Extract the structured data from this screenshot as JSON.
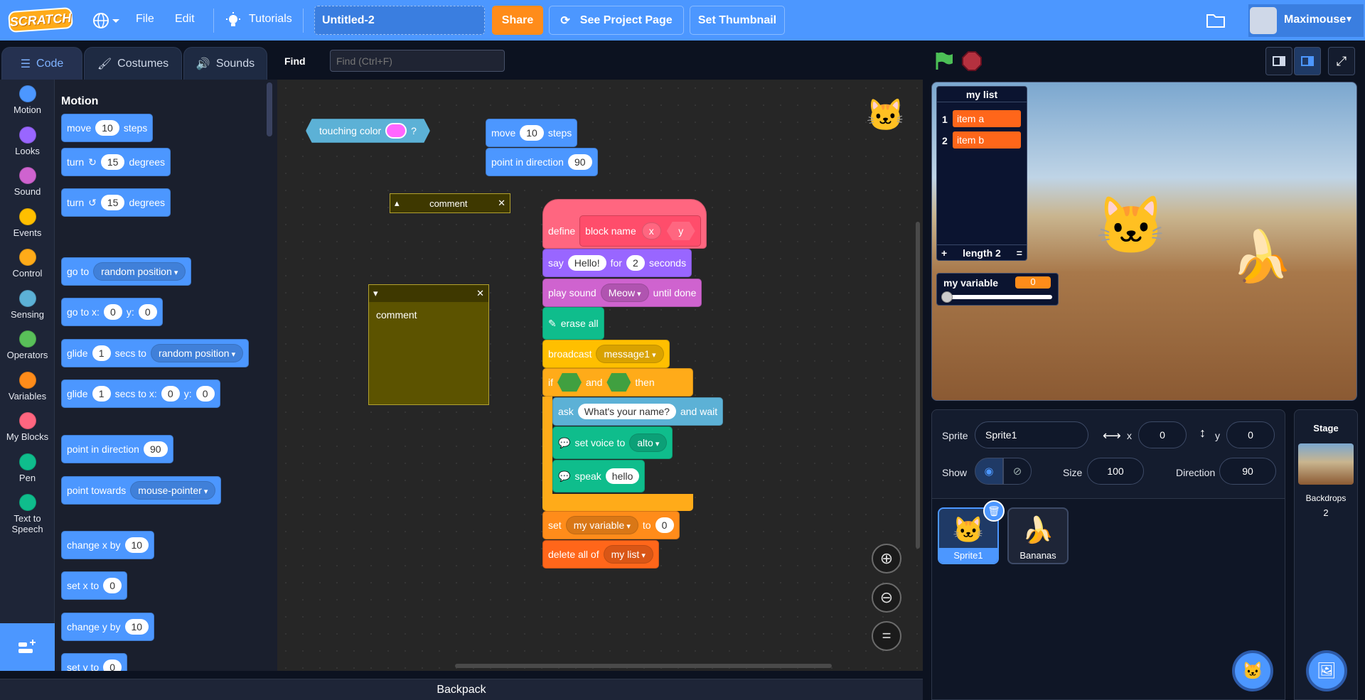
{
  "menubar": {
    "logo": "SCRATCH",
    "file": "File",
    "edit": "Edit",
    "tutorials": "Tutorials",
    "project_title": "Untitled-2",
    "share": "Share",
    "see_project_page": "See Project Page",
    "set_thumbnail": "Set Thumbnail",
    "username": "Maximouse"
  },
  "tabs": {
    "code": "Code",
    "costumes": "Costumes",
    "sounds": "Sounds"
  },
  "find": {
    "label": "Find",
    "placeholder": "Find (Ctrl+F)"
  },
  "categories": [
    {
      "label": "Motion",
      "color": "#4c97ff"
    },
    {
      "label": "Looks",
      "color": "#9966ff"
    },
    {
      "label": "Sound",
      "color": "#cf63cf"
    },
    {
      "label": "Events",
      "color": "#ffbf00"
    },
    {
      "label": "Control",
      "color": "#ffab19"
    },
    {
      "label": "Sensing",
      "color": "#5cb1d6"
    },
    {
      "label": "Operators",
      "color": "#59c059"
    },
    {
      "label": "Variables",
      "color": "#ff8c1a"
    },
    {
      "label": "My Blocks",
      "color": "#ff6680"
    },
    {
      "label": "Pen",
      "color": "#0fbd8c"
    },
    {
      "label": "Text to Speech",
      "color": "#0fbd8c"
    }
  ],
  "palette": {
    "heading": "Motion",
    "move": {
      "a": "move",
      "n": "10",
      "b": "steps"
    },
    "turn_cw": {
      "a": "turn",
      "n": "15",
      "b": "degrees"
    },
    "turn_ccw": {
      "a": "turn",
      "n": "15",
      "b": "degrees"
    },
    "goto": {
      "a": "go to",
      "dd": "random position"
    },
    "gotoxy": {
      "a": "go to x:",
      "x": "0",
      "yl": "y:",
      "y": "0"
    },
    "glide": {
      "a": "glide",
      "n": "1",
      "b": "secs to",
      "dd": "random position"
    },
    "glidexy": {
      "a": "glide",
      "n": "1",
      "b": "secs to x:",
      "x": "0",
      "yl": "y:",
      "y": "0"
    },
    "pointdir": {
      "a": "point in direction",
      "n": "90"
    },
    "pointtowards": {
      "a": "point towards",
      "dd": "mouse-pointer"
    },
    "changex": {
      "a": "change x by",
      "n": "10"
    },
    "setx": {
      "a": "set x to",
      "n": "0"
    },
    "changey": {
      "a": "change y by",
      "n": "10"
    },
    "sety": {
      "a": "set y to",
      "n": "0"
    }
  },
  "script": {
    "touching": {
      "a": "touching color",
      "b": "?"
    },
    "move": {
      "a": "move",
      "n": "10",
      "b": "steps"
    },
    "pointdir": {
      "a": "point in direction",
      "n": "90"
    },
    "comment_small": "comment",
    "comment_big": "comment",
    "define": {
      "a": "define",
      "name": "block name",
      "x": "x",
      "y": "y"
    },
    "say": {
      "a": "say",
      "msg": "Hello!",
      "b": "for",
      "n": "2",
      "c": "seconds"
    },
    "playsound": {
      "a": "play sound",
      "dd": "Meow",
      "b": "until done"
    },
    "erase": "erase all",
    "broadcast": {
      "a": "broadcast",
      "dd": "message1"
    },
    "if": {
      "a": "if",
      "and": "and",
      "then": "then"
    },
    "ask": {
      "a": "ask",
      "q": "What's your name?",
      "b": "and wait"
    },
    "setvoice": {
      "a": "set voice to",
      "dd": "alto"
    },
    "speak": {
      "a": "speak",
      "msg": "hello"
    },
    "setvar": {
      "a": "set",
      "dd": "my variable",
      "b": "to",
      "n": "0"
    },
    "deleteall": {
      "a": "delete all of",
      "dd": "my list"
    }
  },
  "backpack": "Backpack",
  "stage": {
    "list_title": "my list",
    "list_items": [
      {
        "i": "1",
        "v": "item a"
      },
      {
        "i": "2",
        "v": "item b"
      }
    ],
    "list_add": "+",
    "list_length": "length 2",
    "list_eq": "=",
    "var_name": "my variable",
    "var_value": "0"
  },
  "sprite_info": {
    "sprite_label": "Sprite",
    "sprite_name": "Sprite1",
    "x_label": "x",
    "x": "0",
    "y_label": "y",
    "y": "0",
    "show_label": "Show",
    "size_label": "Size",
    "size": "100",
    "direction_label": "Direction",
    "direction": "90"
  },
  "sprites": [
    {
      "name": "Sprite1"
    },
    {
      "name": "Bananas"
    }
  ],
  "stage_pane": {
    "title": "Stage",
    "backdrops_label": "Backdrops",
    "backdrops_count": "2"
  }
}
